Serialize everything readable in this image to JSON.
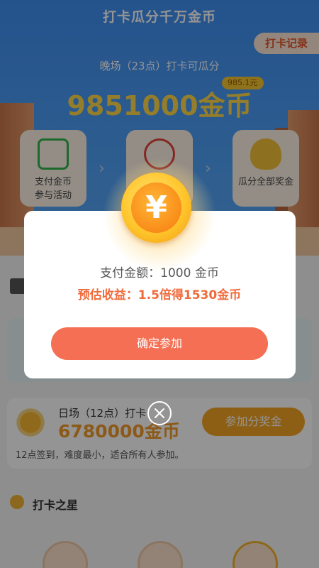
{
  "header": {
    "title": "打卡瓜分千万金币",
    "record_label": "打卡记录"
  },
  "session": {
    "subtitle": "晚场（23点）打卡可瓜分",
    "prize_pill": "985.1元",
    "pool": "9851000金币"
  },
  "steps": [
    {
      "label": "支付金币\n参与活动",
      "icon": "wallet-icon"
    },
    {
      "label": "",
      "icon": "alarm-clock-icon"
    },
    {
      "label": "瓜分全部奖金",
      "icon": "money-bag-icon"
    }
  ],
  "day_session": {
    "title": "日场（12点）打卡",
    "pool": "6780000金币",
    "description": "12点签到，难度最小，适合所有人参加。",
    "join_label": "参加分奖金"
  },
  "star_section": {
    "title": "打卡之星"
  },
  "dialog": {
    "amount": "支付金额：1000 金币",
    "earnings": "预估收益：1.5倍得1530金币",
    "confirm_label": "确定参加",
    "coin_symbol": "¥"
  },
  "colors": {
    "hero_blue": "#4a9cf6",
    "accent_orange": "#f46f53",
    "gold": "#f3a425"
  }
}
